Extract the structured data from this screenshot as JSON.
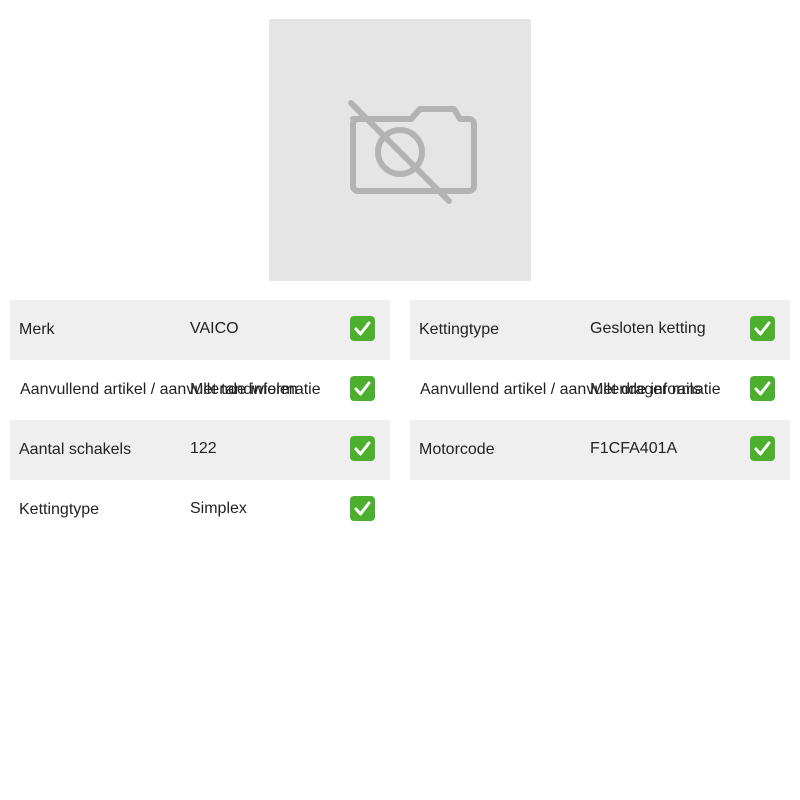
{
  "image": {
    "icon": "no-photo-icon",
    "background": "#e5e5e5",
    "icon_color": "#b3b3b3"
  },
  "check_icon": "check-mark-icon",
  "check_color": "#4caf2e",
  "left_table": [
    {
      "label": "Merk",
      "value": "VAICO"
    },
    {
      "label": "Aanvullend artikel / aanvullende informatie",
      "value": "Met tandwielen"
    },
    {
      "label": "Aantal schakels",
      "value": "122"
    },
    {
      "label": "Kettingtype",
      "value": "Simplex"
    }
  ],
  "right_table": [
    {
      "label": "Kettingtype",
      "value": "Gesloten ketting"
    },
    {
      "label": "Aanvullend artikel / aanvullende informatie",
      "value": "Met drager rails"
    },
    {
      "label": "Motorcode",
      "value": "F1CFA401A"
    }
  ]
}
